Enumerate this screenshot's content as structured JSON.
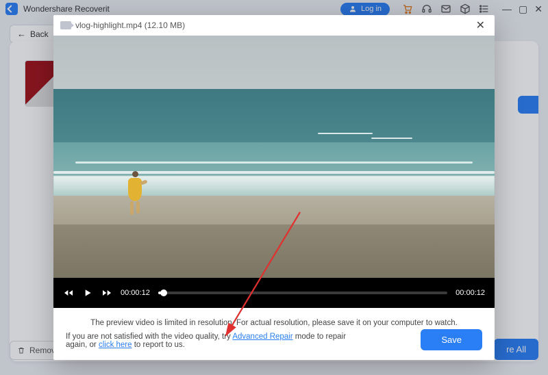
{
  "titlebar": {
    "app_name": "Wondershare Recoverit",
    "login_label": "Log in"
  },
  "toolbar": {
    "back_label": "Back",
    "remove_label": "Remove",
    "save_all_label": "re All"
  },
  "modal": {
    "filename": "vlog-highlight.mp4",
    "filesize": "(12.10  MB)",
    "time_current": "00:00:12",
    "time_total": "00:00:12",
    "note_line1": "The preview video is limited in resolution. For actual resolution, please save it on your computer to watch.",
    "note_prefix": "If you are not satisfied with the video quality, try ",
    "advanced_repair": "Advanced Repair",
    "note_mid": " mode to repair again, or ",
    "click_here": "click here",
    "note_suffix": " to report to us.",
    "save_label": "Save"
  }
}
